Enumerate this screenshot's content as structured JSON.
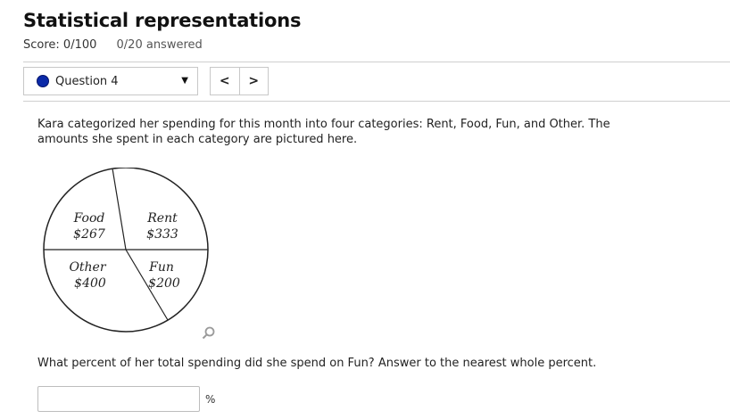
{
  "header": {
    "title": "Statistical representations",
    "score": "Score: 0/100",
    "answered": "0/20 answered"
  },
  "question_nav": {
    "selected": "Question 4",
    "dot_color": "#0b2aa8",
    "prev_label": "<",
    "next_label": ">"
  },
  "problem": {
    "prompt": "Kara categorized her spending for this month into four categories: Rent, Food, Fun, and Other. The amounts she spent in each category are pictured here.",
    "question": "What percent of her total spending did she spend on Fun? Answer to the nearest whole percent.",
    "answer_value": "",
    "unit": "%"
  },
  "chart_data": {
    "type": "pie",
    "slices": [
      {
        "label": "Rent",
        "value": 333,
        "value_label": "$333"
      },
      {
        "label": "Food",
        "value": 267,
        "value_label": "$267"
      },
      {
        "label": "Other",
        "value": 400,
        "value_label": "$400"
      },
      {
        "label": "Fun",
        "value": 200,
        "value_label": "$200"
      }
    ]
  }
}
